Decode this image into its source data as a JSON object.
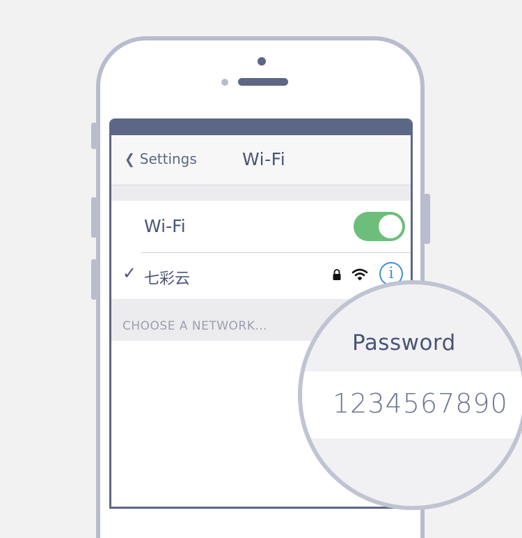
{
  "nav": {
    "back_label": "Settings",
    "title": "Wi-Fi"
  },
  "wifi_toggle": {
    "label": "Wi-Fi",
    "state": "on"
  },
  "connected_network": {
    "name": "七彩云",
    "check_glyph": "✓",
    "info_glyph": "i",
    "icons": [
      "lock-icon",
      "wifi-signal-icon",
      "info-icon"
    ]
  },
  "section": {
    "label": "CHOOSE A NETWORK..."
  },
  "password_popup": {
    "label": "Password",
    "value": "1234567890"
  },
  "colors": {
    "accent_dark": "#5c6785",
    "toggle_on": "#6cbe7a",
    "info_blue": "#3d8de3",
    "frame": "#b8bccd"
  }
}
